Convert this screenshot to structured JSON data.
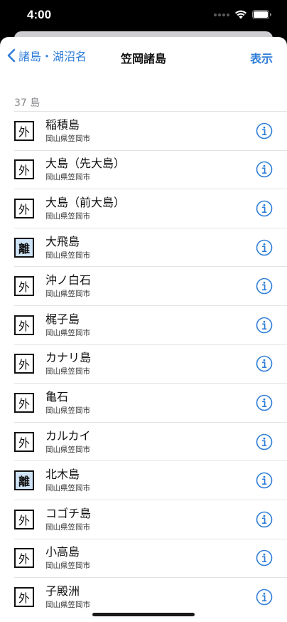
{
  "status": {
    "time": "4:00"
  },
  "nav": {
    "back_label": "諸島・湖沼名",
    "title": "笠岡諸島",
    "action_label": "表示"
  },
  "section": {
    "header": "37 島"
  },
  "colors": {
    "accent": "#2f7ed8",
    "remote_badge_bg": "#cfe3f7"
  },
  "items": [
    {
      "badge": "外",
      "kind": "outer",
      "name": "稲積島",
      "location": "岡山県笠岡市"
    },
    {
      "badge": "外",
      "kind": "outer",
      "name": "大島（先大島）",
      "location": "岡山県笠岡市"
    },
    {
      "badge": "外",
      "kind": "outer",
      "name": "大島（前大島）",
      "location": "岡山県笠岡市"
    },
    {
      "badge": "離",
      "kind": "remote",
      "name": "大飛島",
      "location": "岡山県笠岡市"
    },
    {
      "badge": "外",
      "kind": "outer",
      "name": "沖ノ白石",
      "location": "岡山県笠岡市"
    },
    {
      "badge": "外",
      "kind": "outer",
      "name": "梶子島",
      "location": "岡山県笠岡市"
    },
    {
      "badge": "外",
      "kind": "outer",
      "name": "カナリ島",
      "location": "岡山県笠岡市"
    },
    {
      "badge": "外",
      "kind": "outer",
      "name": "亀石",
      "location": "岡山県笠岡市"
    },
    {
      "badge": "外",
      "kind": "outer",
      "name": "カルカイ",
      "location": "岡山県笠岡市"
    },
    {
      "badge": "離",
      "kind": "remote",
      "name": "北木島",
      "location": "岡山県笠岡市"
    },
    {
      "badge": "外",
      "kind": "outer",
      "name": "コゴチ島",
      "location": "岡山県笠岡市"
    },
    {
      "badge": "外",
      "kind": "outer",
      "name": "小高島",
      "location": "岡山県笠岡市"
    },
    {
      "badge": "外",
      "kind": "outer",
      "name": "子殿洲",
      "location": "岡山県笠岡市"
    }
  ]
}
